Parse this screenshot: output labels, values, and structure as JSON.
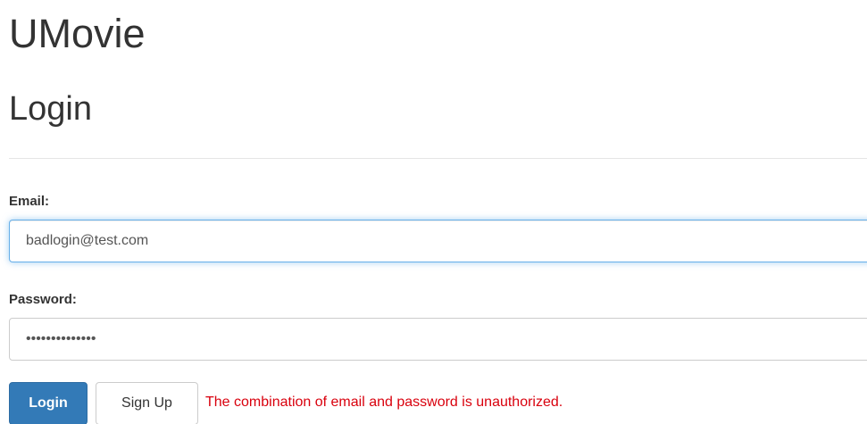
{
  "app": {
    "title": "UMovie"
  },
  "page": {
    "title": "Login"
  },
  "form": {
    "email_label": "Email:",
    "email_value": "badlogin@test.com",
    "password_label": "Password:",
    "password_value": "••••••••••••••"
  },
  "buttons": {
    "login_label": "Login",
    "signup_label": "Sign Up"
  },
  "error": {
    "message": "The combination of email and password is unauthorized.",
    "color": "#d9000d"
  },
  "colors": {
    "primary": "#337ab7",
    "focus_border": "#66afe9"
  }
}
